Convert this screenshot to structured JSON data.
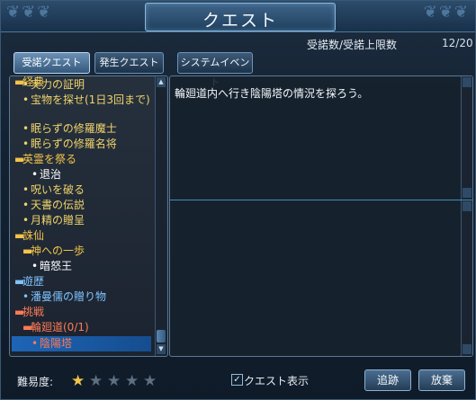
{
  "window": {
    "title": "クエスト"
  },
  "header": {
    "accept_label": "受諾数/受諾上限数",
    "accept_count": "12/20"
  },
  "tabs": [
    {
      "label": "受諾クエスト",
      "active": true
    },
    {
      "label": "発生クエスト",
      "active": false
    },
    {
      "label": "システムイベント",
      "active": false
    }
  ],
  "tree": [
    {
      "text": "経典",
      "kind": "category",
      "bullet": "▬"
    },
    {
      "text": "実力の証明",
      "kind": "quest",
      "bullet": "•"
    },
    {
      "text": "宝物を探せ(1日3回まで)",
      "kind": "quest",
      "bullet": "•"
    },
    {
      "text": "眠らずの修羅魔士",
      "kind": "quest",
      "bullet": "•"
    },
    {
      "text": "眠らずの修羅名将",
      "kind": "quest",
      "bullet": "•"
    },
    {
      "text": "英霊を祭る",
      "kind": "category",
      "bullet": "▬"
    },
    {
      "text": "退治",
      "kind": "sub",
      "bullet": "•"
    },
    {
      "text": "呪いを破る",
      "kind": "quest",
      "bullet": "•"
    },
    {
      "text": "天書の伝説",
      "kind": "quest",
      "bullet": "•"
    },
    {
      "text": "月精の贈呈",
      "kind": "quest",
      "bullet": "•"
    },
    {
      "text": "誅仙",
      "kind": "category",
      "bullet": "▬"
    },
    {
      "text": "神への一歩",
      "kind": "category",
      "bullet": "▬"
    },
    {
      "text": "暗怒王",
      "kind": "sub",
      "bullet": "•"
    },
    {
      "text": "遊歴",
      "kind": "blue-cat",
      "bullet": "▬"
    },
    {
      "text": "潘曼儒の贈り物",
      "kind": "blue",
      "bullet": "•"
    },
    {
      "text": "挑戦",
      "kind": "red-cat",
      "bullet": "▬"
    },
    {
      "text": "輪廻道(0/1)",
      "kind": "red-cat",
      "bullet": "▬"
    },
    {
      "text": "陰陽塔",
      "kind": "red-selected",
      "bullet": "•"
    }
  ],
  "description": {
    "text": "輪廻道内へ行き陰陽塔の情況を探ろう。"
  },
  "footer": {
    "difficulty_label": "難易度:",
    "stars": 1,
    "max_stars": 5,
    "show_quest_label": "クエスト表示",
    "show_quest_checked": true,
    "track_label": "追跡",
    "abandon_label": "放棄"
  },
  "colors": {
    "category": "#f2c44a",
    "blue": "#7fc3ff",
    "red": "#ff7a55",
    "selected_bg": "#1e65b6"
  }
}
